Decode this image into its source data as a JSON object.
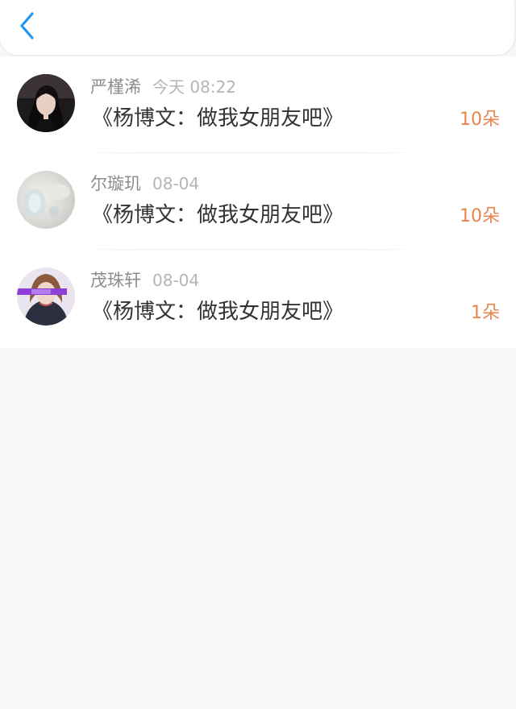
{
  "header": {
    "back_icon": "chevron-left-icon",
    "accent_color": "#2196f3"
  },
  "gifts": [
    {
      "name": "严槿浠",
      "time": "今天 08:22",
      "title": "《杨博文：做我女朋友吧》",
      "count": "10朵",
      "avatar": "photo-avatar-girl-dark-hair"
    },
    {
      "name": "尔璇玑",
      "time": "08-04",
      "title": "《杨博文：做我女朋友吧》",
      "count": "10朵",
      "avatar": "photo-avatar-bottle-blur"
    },
    {
      "name": "茂珠轩",
      "time": "08-04",
      "title": "《杨博文：做我女朋友吧》",
      "count": "1朵",
      "avatar": "photo-avatar-girl-purple-banner"
    }
  ],
  "colors": {
    "count": "#e7864f",
    "name": "#8d8d8d",
    "time": "#b5b5b5",
    "title": "#333333",
    "page_bg": "#f8f6f7"
  }
}
